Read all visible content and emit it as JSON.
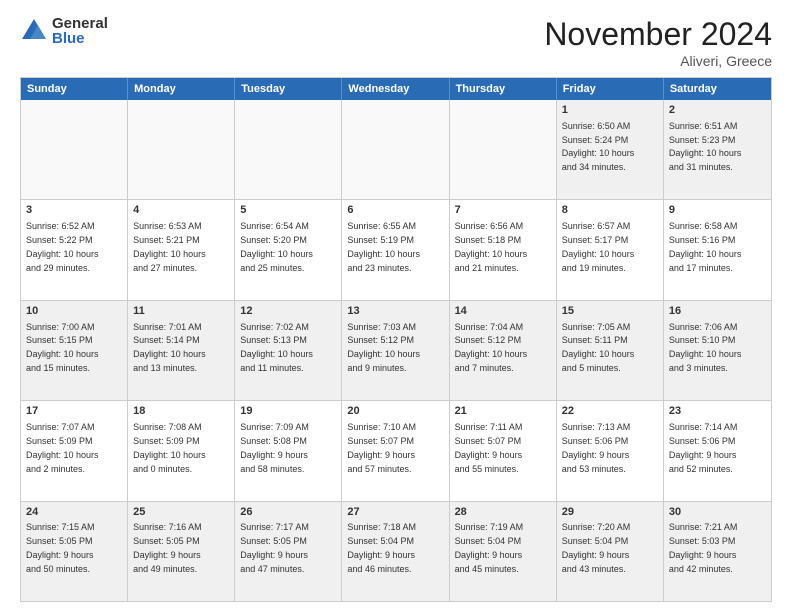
{
  "logo": {
    "general": "General",
    "blue": "Blue"
  },
  "title": "November 2024",
  "location": "Aliveri, Greece",
  "headers": [
    "Sunday",
    "Monday",
    "Tuesday",
    "Wednesday",
    "Thursday",
    "Friday",
    "Saturday"
  ],
  "weeks": [
    [
      {
        "day": "",
        "text": "",
        "empty": true
      },
      {
        "day": "",
        "text": "",
        "empty": true
      },
      {
        "day": "",
        "text": "",
        "empty": true
      },
      {
        "day": "",
        "text": "",
        "empty": true
      },
      {
        "day": "",
        "text": "",
        "empty": true
      },
      {
        "day": "1",
        "text": "Sunrise: 6:50 AM\nSunset: 5:24 PM\nDaylight: 10 hours\nand 34 minutes."
      },
      {
        "day": "2",
        "text": "Sunrise: 6:51 AM\nSunset: 5:23 PM\nDaylight: 10 hours\nand 31 minutes."
      }
    ],
    [
      {
        "day": "3",
        "text": "Sunrise: 6:52 AM\nSunset: 5:22 PM\nDaylight: 10 hours\nand 29 minutes."
      },
      {
        "day": "4",
        "text": "Sunrise: 6:53 AM\nSunset: 5:21 PM\nDaylight: 10 hours\nand 27 minutes."
      },
      {
        "day": "5",
        "text": "Sunrise: 6:54 AM\nSunset: 5:20 PM\nDaylight: 10 hours\nand 25 minutes."
      },
      {
        "day": "6",
        "text": "Sunrise: 6:55 AM\nSunset: 5:19 PM\nDaylight: 10 hours\nand 23 minutes."
      },
      {
        "day": "7",
        "text": "Sunrise: 6:56 AM\nSunset: 5:18 PM\nDaylight: 10 hours\nand 21 minutes."
      },
      {
        "day": "8",
        "text": "Sunrise: 6:57 AM\nSunset: 5:17 PM\nDaylight: 10 hours\nand 19 minutes."
      },
      {
        "day": "9",
        "text": "Sunrise: 6:58 AM\nSunset: 5:16 PM\nDaylight: 10 hours\nand 17 minutes."
      }
    ],
    [
      {
        "day": "10",
        "text": "Sunrise: 7:00 AM\nSunset: 5:15 PM\nDaylight: 10 hours\nand 15 minutes."
      },
      {
        "day": "11",
        "text": "Sunrise: 7:01 AM\nSunset: 5:14 PM\nDaylight: 10 hours\nand 13 minutes."
      },
      {
        "day": "12",
        "text": "Sunrise: 7:02 AM\nSunset: 5:13 PM\nDaylight: 10 hours\nand 11 minutes."
      },
      {
        "day": "13",
        "text": "Sunrise: 7:03 AM\nSunset: 5:12 PM\nDaylight: 10 hours\nand 9 minutes."
      },
      {
        "day": "14",
        "text": "Sunrise: 7:04 AM\nSunset: 5:12 PM\nDaylight: 10 hours\nand 7 minutes."
      },
      {
        "day": "15",
        "text": "Sunrise: 7:05 AM\nSunset: 5:11 PM\nDaylight: 10 hours\nand 5 minutes."
      },
      {
        "day": "16",
        "text": "Sunrise: 7:06 AM\nSunset: 5:10 PM\nDaylight: 10 hours\nand 3 minutes."
      }
    ],
    [
      {
        "day": "17",
        "text": "Sunrise: 7:07 AM\nSunset: 5:09 PM\nDaylight: 10 hours\nand 2 minutes."
      },
      {
        "day": "18",
        "text": "Sunrise: 7:08 AM\nSunset: 5:09 PM\nDaylight: 10 hours\nand 0 minutes."
      },
      {
        "day": "19",
        "text": "Sunrise: 7:09 AM\nSunset: 5:08 PM\nDaylight: 9 hours\nand 58 minutes."
      },
      {
        "day": "20",
        "text": "Sunrise: 7:10 AM\nSunset: 5:07 PM\nDaylight: 9 hours\nand 57 minutes."
      },
      {
        "day": "21",
        "text": "Sunrise: 7:11 AM\nSunset: 5:07 PM\nDaylight: 9 hours\nand 55 minutes."
      },
      {
        "day": "22",
        "text": "Sunrise: 7:13 AM\nSunset: 5:06 PM\nDaylight: 9 hours\nand 53 minutes."
      },
      {
        "day": "23",
        "text": "Sunrise: 7:14 AM\nSunset: 5:06 PM\nDaylight: 9 hours\nand 52 minutes."
      }
    ],
    [
      {
        "day": "24",
        "text": "Sunrise: 7:15 AM\nSunset: 5:05 PM\nDaylight: 9 hours\nand 50 minutes."
      },
      {
        "day": "25",
        "text": "Sunrise: 7:16 AM\nSunset: 5:05 PM\nDaylight: 9 hours\nand 49 minutes."
      },
      {
        "day": "26",
        "text": "Sunrise: 7:17 AM\nSunset: 5:05 PM\nDaylight: 9 hours\nand 47 minutes."
      },
      {
        "day": "27",
        "text": "Sunrise: 7:18 AM\nSunset: 5:04 PM\nDaylight: 9 hours\nand 46 minutes."
      },
      {
        "day": "28",
        "text": "Sunrise: 7:19 AM\nSunset: 5:04 PM\nDaylight: 9 hours\nand 45 minutes."
      },
      {
        "day": "29",
        "text": "Sunrise: 7:20 AM\nSunset: 5:04 PM\nDaylight: 9 hours\nand 43 minutes."
      },
      {
        "day": "30",
        "text": "Sunrise: 7:21 AM\nSunset: 5:03 PM\nDaylight: 9 hours\nand 42 minutes."
      }
    ]
  ]
}
